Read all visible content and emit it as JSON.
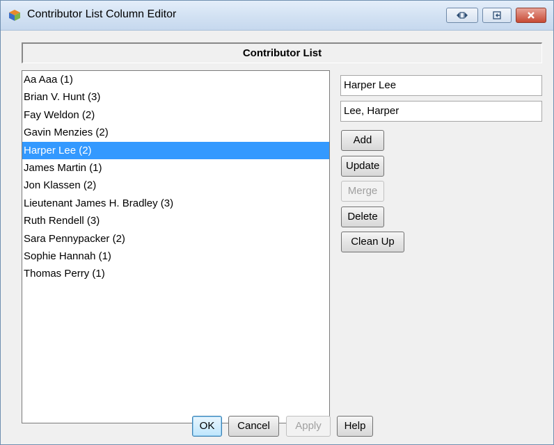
{
  "window": {
    "title": "Contributor List Column Editor",
    "title_buttons": [
      "restore-icon",
      "pin-icon",
      "close-icon"
    ]
  },
  "header": {
    "title": "Contributor List"
  },
  "contributors": [
    "Aa Aaa (1)",
    "Brian V. Hunt (3)",
    "Fay Weldon (2)",
    "Gavin Menzies (2)",
    "Harper Lee (2)",
    "James Martin (1)",
    "Jon Klassen (2)",
    "Lieutenant James H. Bradley (3)",
    "Ruth Rendell (3)",
    "Sara Pennypacker (2)",
    "Sophie Hannah (1)",
    "Thomas Perry (1)"
  ],
  "selected_index": 4,
  "fields": {
    "name_value": "Harper Lee",
    "sort_name_value": "Lee, Harper"
  },
  "actions": {
    "add": "Add",
    "update": "Update",
    "merge": "Merge",
    "delete": "Delete",
    "clean_up": "Clean Up"
  },
  "footer": {
    "ok": "OK",
    "cancel": "Cancel",
    "apply": "Apply",
    "help": "Help"
  },
  "colors": {
    "selection": "#3399ff",
    "titlebar": "#d3e2f3",
    "close_button": "#c74a35"
  }
}
